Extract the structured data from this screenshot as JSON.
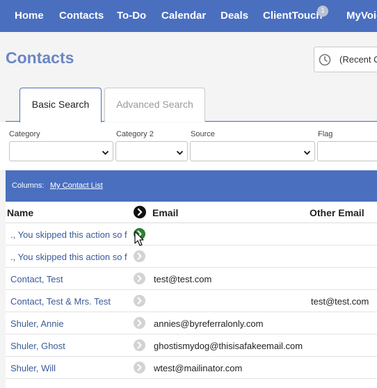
{
  "nav": {
    "items": [
      "Home",
      "Contacts",
      "To-Do",
      "Calendar",
      "Deals",
      "ClientTouch",
      "MyVoice"
    ],
    "badge": "1"
  },
  "page": {
    "title": "Contacts"
  },
  "recent": {
    "label": "(Recent Contacts)"
  },
  "tabs": {
    "basic": "Basic Search",
    "advanced": "Advanced Search"
  },
  "filters": {
    "category": "Category",
    "category2": "Category 2",
    "source": "Source",
    "flag": "Flag"
  },
  "columns": {
    "label": "Columns:",
    "link": "My Contact List"
  },
  "table": {
    "headers": {
      "name": "Name",
      "email": "Email",
      "other_email": "Other Email"
    },
    "rows": [
      {
        "name": "., You skipped this action so f",
        "email": "",
        "other": "",
        "active": true
      },
      {
        "name": "., You skipped this action so f",
        "email": "",
        "other": "",
        "active": false
      },
      {
        "name": "Contact, Test",
        "email": "test@test.com",
        "other": "",
        "active": false
      },
      {
        "name": "Contact, Test & Mrs. Test",
        "email": "",
        "other": "test@test.com",
        "active": false
      },
      {
        "name": "Shuler, Annie",
        "email": "annies@byreferralonly.com",
        "other": "",
        "active": false
      },
      {
        "name": "Shuler, Ghost",
        "email": "ghostismydog@thisisafakeemail.com",
        "other": "",
        "active": false
      },
      {
        "name": "Shuler, Will",
        "email": "wtest@mailinator.com",
        "other": "",
        "active": false
      }
    ]
  },
  "colors": {
    "primary": "#4a6fbf",
    "title": "#6b86c5",
    "link": "#3a5a9a",
    "active_go": "#2e7d32"
  }
}
